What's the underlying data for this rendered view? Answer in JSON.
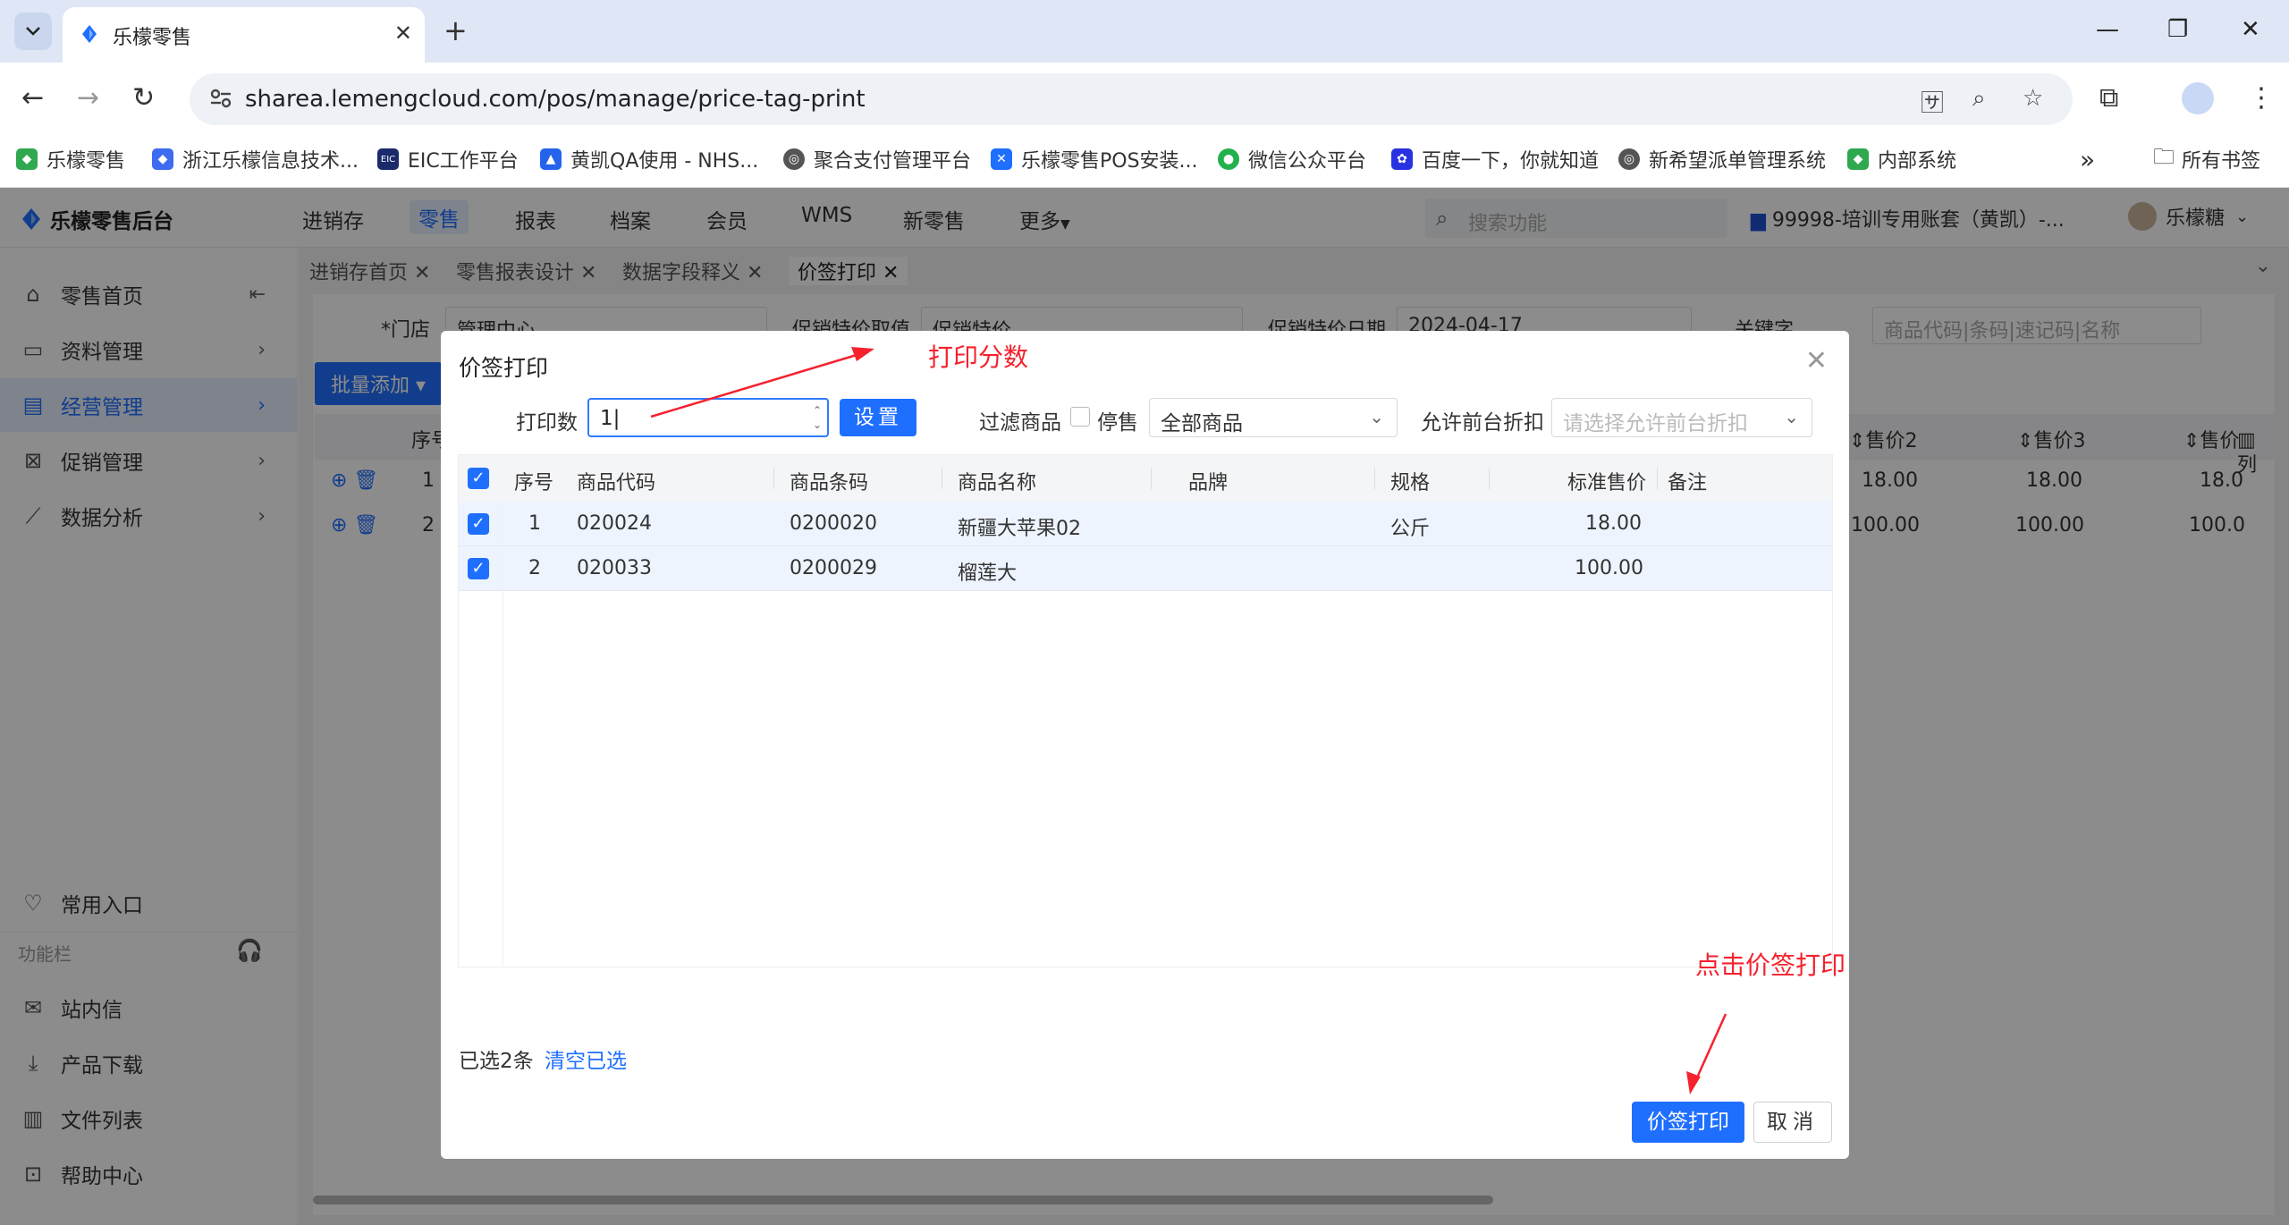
{
  "browser": {
    "tab_title": "乐檬零售",
    "url": "sharea.lemengcloud.com/pos/manage/price-tag-print",
    "bookmarks": [
      {
        "label": "乐檬零售",
        "icon": "lemeng-icon",
        "color": "#2fa84f"
      },
      {
        "label": "浙江乐檬信息技术...",
        "icon": "lemeng-blue-icon",
        "color": "#3d6cf0"
      },
      {
        "label": "EIC工作平台",
        "icon": "eic-icon",
        "color": "#1a2a6b"
      },
      {
        "label": "黄凯QA使用 - NHS...",
        "icon": "jira-icon",
        "color": "#2563eb"
      },
      {
        "label": "聚合支付管理平台",
        "icon": "globe-icon",
        "color": "#555555"
      },
      {
        "label": "乐檬零售POS安装...",
        "icon": "confluence-icon",
        "color": "#1f6fff"
      },
      {
        "label": "微信公众平台",
        "icon": "wechat-icon",
        "color": "#22b14c"
      },
      {
        "label": "百度一下，你就知道",
        "icon": "baidu-icon",
        "color": "#2932e1"
      },
      {
        "label": "新希望派单管理系统",
        "icon": "globe-icon",
        "color": "#555555"
      },
      {
        "label": "内部系统",
        "icon": "lemeng-icon",
        "color": "#2fa84f"
      }
    ],
    "all_bookmarks": "所有书签"
  },
  "app": {
    "logo": "乐檬零售后台",
    "menu": [
      "进销存",
      "零售",
      "报表",
      "档案",
      "会员",
      "WMS",
      "新零售",
      "更多"
    ],
    "active_menu": "零售",
    "search_placeholder": "搜索功能",
    "account": "99998-培训专用账套（黄凯）-...",
    "user": "乐檬糖"
  },
  "sidebar": {
    "items": [
      {
        "label": "零售首页",
        "icon": "home-icon"
      },
      {
        "label": "资料管理",
        "icon": "folder-icon"
      },
      {
        "label": "经营管理",
        "icon": "chart-icon"
      },
      {
        "label": "促销管理",
        "icon": "promotion-icon"
      },
      {
        "label": "数据分析",
        "icon": "analytics-icon"
      }
    ],
    "bottom_items": [
      {
        "label": "常用入口",
        "icon": "heart-icon"
      },
      {
        "label": "站内信",
        "icon": "mail-icon"
      },
      {
        "label": "产品下载",
        "icon": "download-icon"
      },
      {
        "label": "文件列表",
        "icon": "file-list-icon"
      },
      {
        "label": "帮助中心",
        "icon": "help-icon"
      }
    ],
    "section_label": "功能栏"
  },
  "page_tabs": [
    "进销存首页",
    "零售报表设计",
    "数据字段释义",
    "价签打印"
  ],
  "background": {
    "store_label": "*门店",
    "store_value": "管理中心",
    "price_source_label": "促销特价取值",
    "price_source_value": "促销特价",
    "date_label": "促销特价日期",
    "date_value": "2024-04-17",
    "keyword_label": "关键字",
    "keyword_placeholder": "商品代码|条码|速记码|名称",
    "batch_add": "批量添加",
    "col_seq": "序号",
    "cols_right": [
      "售价2",
      "售价3",
      "售价"
    ],
    "col_list": "列",
    "rows": [
      {
        "seq": "1",
        "p1": "18.00",
        "p2": "18.00",
        "p3": "18.0"
      },
      {
        "seq": "2",
        "p1": "100.00",
        "p2": "100.00",
        "p3": "100.0"
      }
    ]
  },
  "modal": {
    "title": "价签打印",
    "print_count_label": "打印数",
    "print_count_value": "1",
    "set_button": "设置",
    "filter_label": "过滤商品",
    "stop_sale_label": "停售",
    "filter_value": "全部商品",
    "discount_label": "允许前台折扣",
    "discount_placeholder": "请选择允许前台折扣",
    "columns": [
      "序号",
      "商品代码",
      "商品条码",
      "商品名称",
      "品牌",
      "规格",
      "标准售价",
      "备注"
    ],
    "rows": [
      {
        "seq": "1",
        "code": "020024",
        "barcode": "0200020",
        "name": "新疆大苹果02",
        "brand": "",
        "spec": "公斤",
        "price": "18.00",
        "note": ""
      },
      {
        "seq": "2",
        "code": "020033",
        "barcode": "0200029",
        "name": "榴莲大",
        "brand": "",
        "spec": "",
        "price": "100.00",
        "note": ""
      }
    ],
    "selected_text": "已选2条",
    "clear_link": "清空已选",
    "print_button": "价签打印",
    "cancel_button": "取消"
  },
  "annotations": {
    "print_copies": "打印分数",
    "click_print": "点击价签打印",
    "color": "#f5222d"
  }
}
